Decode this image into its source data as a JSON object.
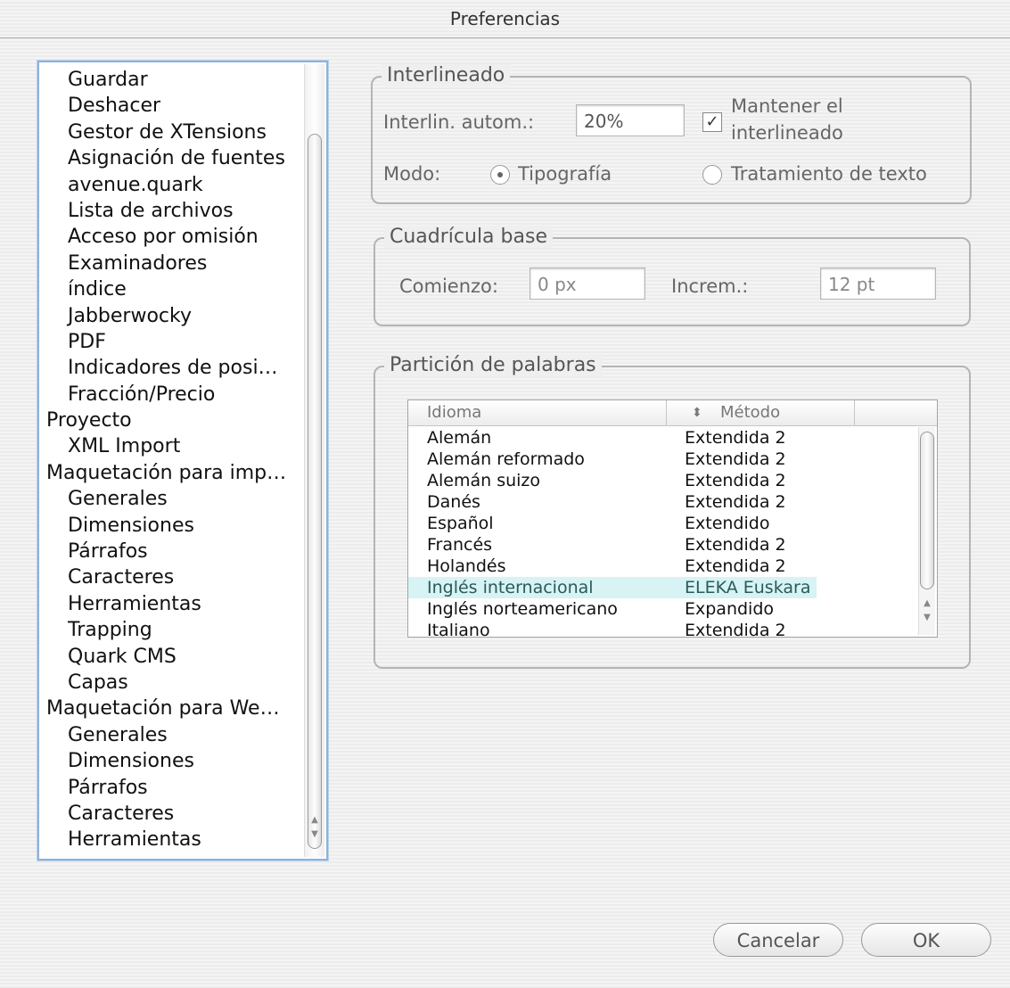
{
  "window": {
    "title": "Preferencias"
  },
  "categories": [
    {
      "label": "Guardar",
      "level": 1
    },
    {
      "label": "Deshacer",
      "level": 1
    },
    {
      "label": "Gestor de XTensions",
      "level": 1
    },
    {
      "label": "Asignación de fuentes",
      "level": 1
    },
    {
      "label": "avenue.quark",
      "level": 1
    },
    {
      "label": "Lista de archivos",
      "level": 1
    },
    {
      "label": "Acceso por omisión",
      "level": 1
    },
    {
      "label": "Examinadores",
      "level": 1
    },
    {
      "label": "índice",
      "level": 1
    },
    {
      "label": "Jabberwocky",
      "level": 1
    },
    {
      "label": "PDF",
      "level": 1
    },
    {
      "label": "Indicadores de posi…",
      "level": 1
    },
    {
      "label": "Fracción/Precio",
      "level": 1
    },
    {
      "label": "Proyecto",
      "level": 0
    },
    {
      "label": "XML Import",
      "level": 1
    },
    {
      "label": "Maquetación para imp…",
      "level": 0
    },
    {
      "label": "Generales",
      "level": 1
    },
    {
      "label": "Dimensiones",
      "level": 1
    },
    {
      "label": "Párrafos",
      "level": 1
    },
    {
      "label": "Caracteres",
      "level": 1
    },
    {
      "label": "Herramientas",
      "level": 1
    },
    {
      "label": "Trapping",
      "level": 1
    },
    {
      "label": "Quark CMS",
      "level": 1
    },
    {
      "label": "Capas",
      "level": 1
    },
    {
      "label": "Maquetación para We…",
      "level": 0
    },
    {
      "label": "Generales",
      "level": 1
    },
    {
      "label": "Dimensiones",
      "level": 1
    },
    {
      "label": "Párrafos",
      "level": 1
    },
    {
      "label": "Caracteres",
      "level": 1
    },
    {
      "label": "Herramientas",
      "level": 1
    }
  ],
  "interlineado": {
    "legend": "Interlineado",
    "auto_label": "Interlin. autom.:",
    "auto_value": "20%",
    "keep_label_line1": "Mantener el",
    "keep_label_line2": "interlineado",
    "keep_checked": true,
    "mode_label": "Modo:",
    "mode_opt1": "Tipografía",
    "mode_opt2": "Tratamiento de texto",
    "mode_selected": "Tipografía"
  },
  "cuadricula": {
    "legend": "Cuadrícula base",
    "start_label": "Comienzo:",
    "start_value": "0 px",
    "incr_label": "Increm.:",
    "incr_value": "12 pt"
  },
  "particion": {
    "legend": "Partición de palabras",
    "col_language": "Idioma",
    "col_method": "Método",
    "sort_icon": "⬍",
    "rows": [
      {
        "language": "Alemán",
        "method": "Extendida 2"
      },
      {
        "language": "Alemán reformado",
        "method": "Extendida 2"
      },
      {
        "language": "Alemán suizo",
        "method": "Extendida 2"
      },
      {
        "language": "Danés",
        "method": "Extendida 2"
      },
      {
        "language": "Español",
        "method": "Extendido"
      },
      {
        "language": "Francés",
        "method": "Extendida 2"
      },
      {
        "language": "Holandés",
        "method": "Extendida 2"
      },
      {
        "language": "Inglés internacional",
        "method": "ELEKA Euskara"
      },
      {
        "language": "Inglés norteamericano",
        "method": "Expandido"
      },
      {
        "language": "Italiano",
        "method": "Extendida 2"
      }
    ],
    "selected_index": 7
  },
  "buttons": {
    "cancel": "Cancelar",
    "ok": "OK"
  }
}
